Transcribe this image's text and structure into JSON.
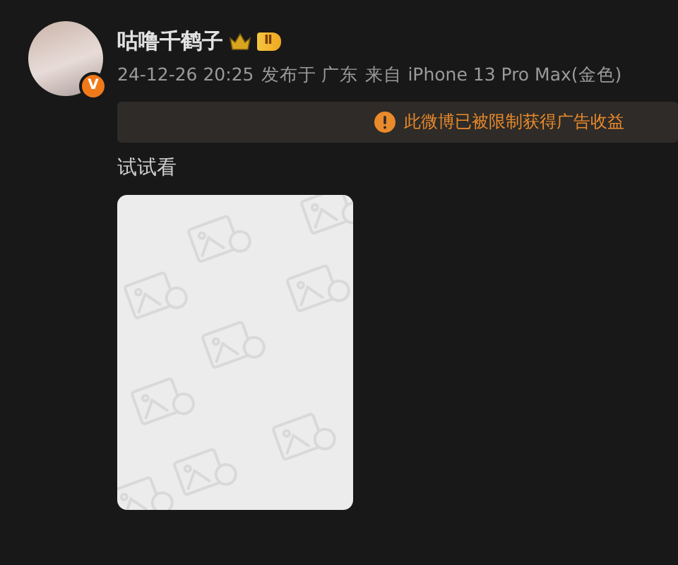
{
  "author": {
    "name": "咕噜千鹤子",
    "verified_mark": "V",
    "level_badge": "Ⅱ"
  },
  "meta": {
    "time": "24-12-26 20:25",
    "location": "发布于 广东",
    "source": "来自 iPhone 13 Pro Max(金色)"
  },
  "notice": {
    "text": "此微博已被限制获得广告收益"
  },
  "post": {
    "text": "试试看"
  }
}
